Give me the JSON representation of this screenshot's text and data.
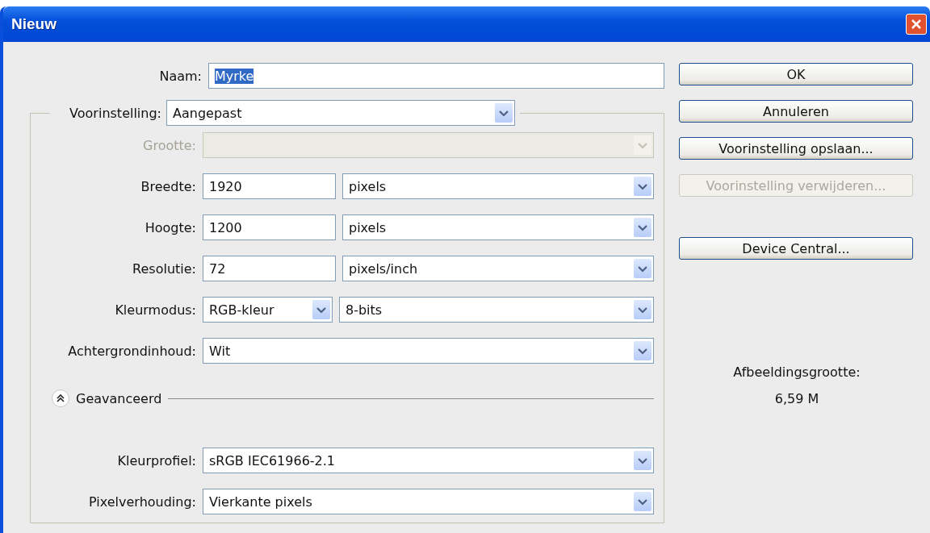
{
  "window": {
    "title": "Nieuw"
  },
  "name_field": {
    "label": "Naam:",
    "value": "Myrke",
    "text_selected": true
  },
  "preset": {
    "label": "Voorinstelling:",
    "value": "Aangepast"
  },
  "rows": [
    {
      "kind": "select",
      "label": "Grootte:",
      "disabled": true
    },
    {
      "kind": "measure",
      "label": "Breedte:",
      "value": "1920",
      "unit": "pixels"
    },
    {
      "kind": "measure",
      "label": "Hoogte:",
      "value": "1200",
      "unit": "pixels"
    },
    {
      "kind": "measure",
      "label": "Resolutie:",
      "value": "72",
      "unit": "pixels/inch"
    },
    {
      "kind": "pair",
      "label": "Kleurmodus:",
      "value": "RGB-kleur",
      "value2": "8-bits"
    },
    {
      "kind": "select",
      "label": "Achtergrondinhoud:",
      "value": "Wit",
      "disabled": false
    }
  ],
  "advanced": {
    "label": "Geavanceerd",
    "expanded": true,
    "rows": [
      {
        "kind": "select",
        "label": "Kleurprofiel:",
        "value": "sRGB IEC61966-2.1",
        "disabled": false
      },
      {
        "kind": "select",
        "label": "Pixelverhouding:",
        "value": "Vierkante pixels",
        "disabled": false
      }
    ]
  },
  "buttons": [
    {
      "label": "OK",
      "disabled": false
    },
    {
      "label": "Annuleren",
      "disabled": false
    },
    {
      "label": "Voorinstelling opslaan...",
      "disabled": false
    },
    {
      "label": "Voorinstelling verwijderen...",
      "disabled": true
    },
    {
      "label": "Device Central...",
      "disabled": false
    }
  ],
  "info": {
    "label": "Afbeeldingsgrootte:",
    "value": "6,59 M"
  }
}
